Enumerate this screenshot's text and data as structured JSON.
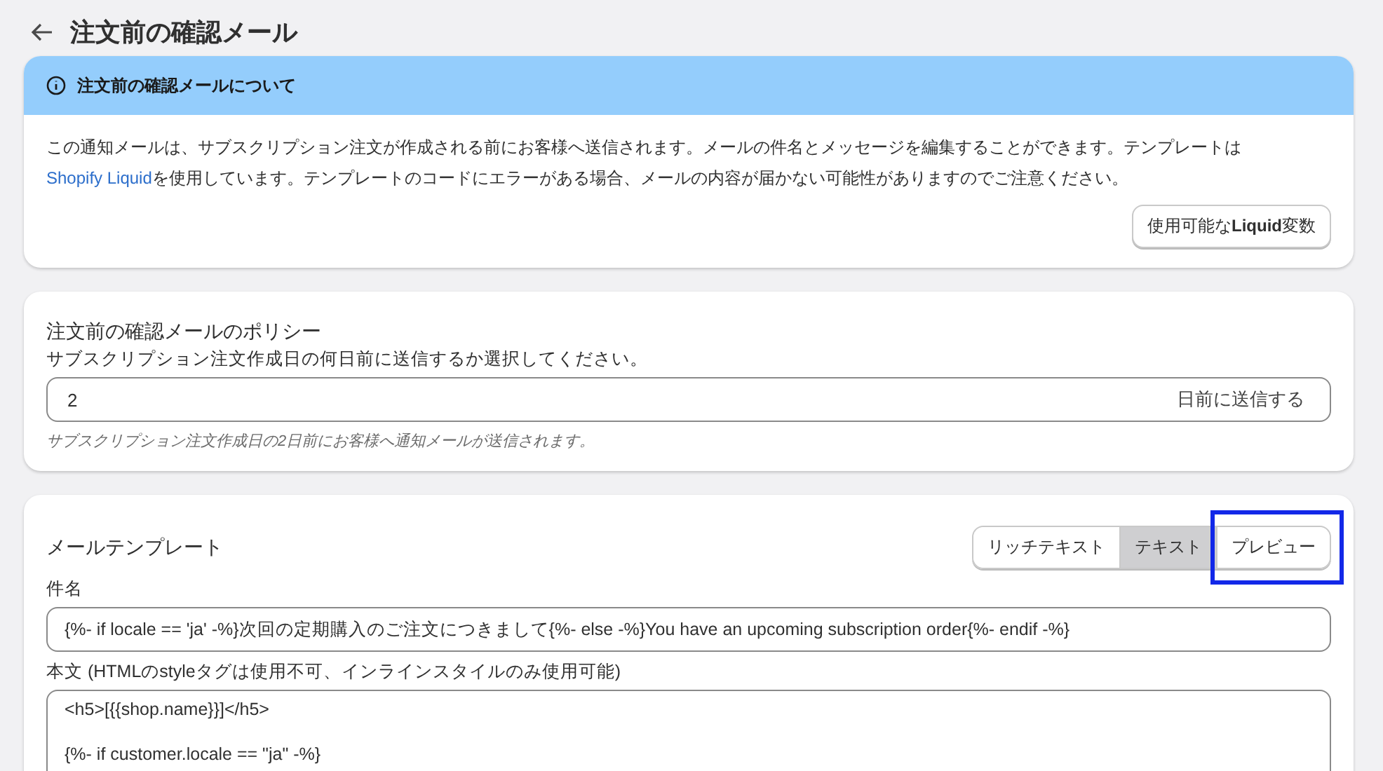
{
  "page": {
    "title": "注文前の確認メール"
  },
  "about": {
    "title": "注文前の確認メールについて",
    "text_before": "この通知メールは、サブスクリプション注文が作成される前にお客様へ送信されます。メールの件名とメッセージを編集することができます。テンプレートは",
    "link": "Shopify Liquid",
    "text_after": "を使用しています。テンプレートのコードにエラーがある場合、メールの内容が届かない可能性がありますのでご注意ください。",
    "button": "使用可能な**Liquid**変数"
  },
  "policy": {
    "title": "注文前の確認メールのポリシー",
    "label": "サブスクリプション注文作成日の何日前に送信するか選択してください。",
    "value": "2",
    "suffix": "日前に送信する",
    "help": "サブスクリプション注文作成日の2日前にお客様へ通知メールが送信されます。"
  },
  "template": {
    "title": "メールテンプレート",
    "tabs": [
      {
        "label": "リッチテキスト",
        "selected": false,
        "highlighted": false
      },
      {
        "label": "テキスト",
        "selected": true,
        "highlighted": false
      },
      {
        "label": "プレビュー",
        "selected": false,
        "highlighted": true
      }
    ],
    "subject_label": "件名",
    "subject": "{%- if locale == 'ja' -%}次回の定期購入のご注文につきまして{%- else -%}You have an upcoming subscription order{%- endif -%}",
    "body_label": "本文 (HTMLのstyleタグは使用不可、インラインスタイルのみ使用可能)",
    "body_paragraphs": [
      "<h5>[{{shop.name}}]</h5>",
      "{%- if customer.locale == \"ja\" -%}"
    ]
  }
}
